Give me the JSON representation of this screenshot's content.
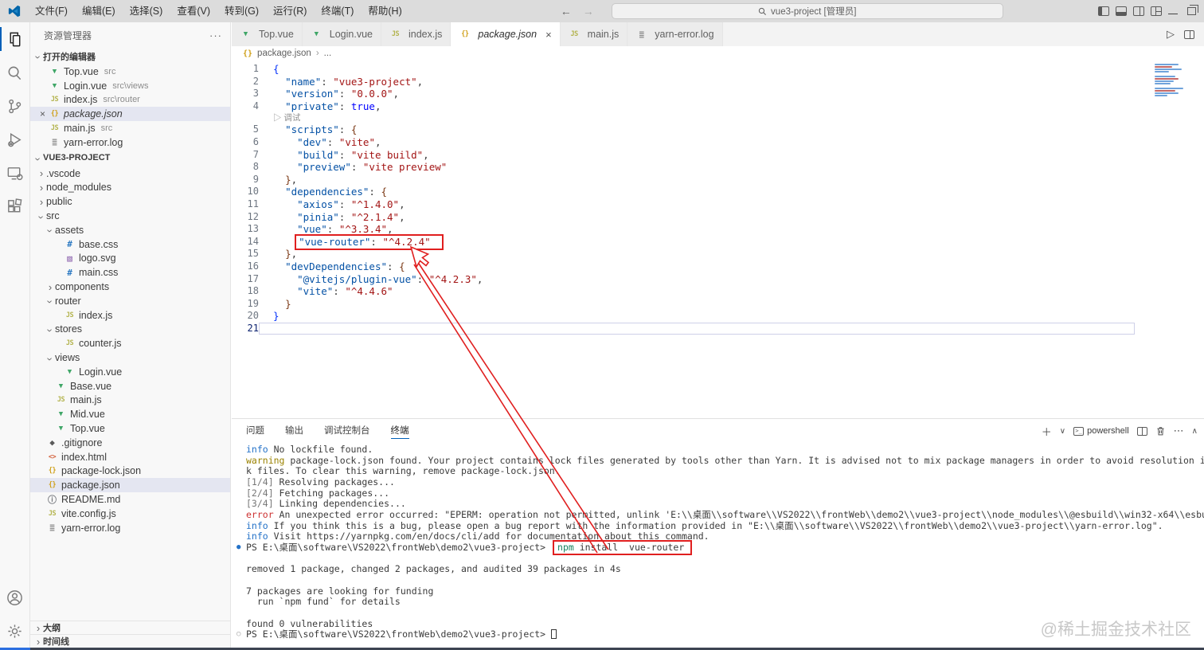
{
  "title_bar": {
    "menus": [
      "文件(F)",
      "编辑(E)",
      "选择(S)",
      "查看(V)",
      "转到(G)",
      "运行(R)",
      "终端(T)",
      "帮助(H)"
    ],
    "search_text": "vue3-project [管理员]",
    "window_controls": [
      "layout-sidebar-left",
      "layout-panel",
      "layout-sidebar-right",
      "customize-layout",
      "minimize",
      "restore"
    ]
  },
  "activity_bar": {
    "items": [
      "explorer-icon",
      "search-icon",
      "source-control-icon",
      "run-debug-icon",
      "remote-explorer-icon",
      "extensions-icon"
    ],
    "bottom_items": [
      "account-icon",
      "settings-gear-icon"
    ]
  },
  "sidebar": {
    "title": "资源管理器",
    "open_editors_label": "打开的编辑器",
    "open_editors": [
      {
        "icon": "vue",
        "name": "Top.vue",
        "path": "src"
      },
      {
        "icon": "vue",
        "name": "Login.vue",
        "path": "src\\views"
      },
      {
        "icon": "js",
        "name": "index.js",
        "path": "src\\router"
      },
      {
        "icon": "json",
        "name": "package.json",
        "path": "",
        "active": true
      },
      {
        "icon": "js",
        "name": "main.js",
        "path": "src"
      },
      {
        "icon": "log",
        "name": "yarn-error.log",
        "path": ""
      }
    ],
    "project_label": "VUE3-PROJECT",
    "tree": [
      {
        "label": ".vscode",
        "folder": "closed",
        "indent": 0
      },
      {
        "label": "node_modules",
        "folder": "closed",
        "indent": 0
      },
      {
        "label": "public",
        "folder": "closed",
        "indent": 0
      },
      {
        "label": "src",
        "folder": "open",
        "indent": 0
      },
      {
        "label": "assets",
        "folder": "open",
        "indent": 1
      },
      {
        "label": "base.css",
        "icon": "css",
        "indent": 2
      },
      {
        "label": "logo.svg",
        "icon": "svg",
        "indent": 2
      },
      {
        "label": "main.css",
        "icon": "css",
        "indent": 2
      },
      {
        "label": "components",
        "folder": "closed",
        "indent": 1
      },
      {
        "label": "router",
        "folder": "open",
        "indent": 1
      },
      {
        "label": "index.js",
        "icon": "js",
        "indent": 2
      },
      {
        "label": "stores",
        "folder": "open",
        "indent": 1
      },
      {
        "label": "counter.js",
        "icon": "js",
        "indent": 2
      },
      {
        "label": "views",
        "folder": "open",
        "indent": 1
      },
      {
        "label": "Login.vue",
        "icon": "vue",
        "indent": 2
      },
      {
        "label": "Base.vue",
        "icon": "vue",
        "indent": 1
      },
      {
        "label": "main.js",
        "icon": "js",
        "indent": 1
      },
      {
        "label": "Mid.vue",
        "icon": "vue",
        "indent": 1
      },
      {
        "label": "Top.vue",
        "icon": "vue",
        "indent": 1
      },
      {
        "label": ".gitignore",
        "icon": "git",
        "indent": 0
      },
      {
        "label": "index.html",
        "icon": "html",
        "indent": 0
      },
      {
        "label": "package-lock.json",
        "icon": "json",
        "indent": 0
      },
      {
        "label": "package.json",
        "icon": "json",
        "indent": 0,
        "selected": true
      },
      {
        "label": "README.md",
        "icon": "info",
        "indent": 0
      },
      {
        "label": "vite.config.js",
        "icon": "js",
        "indent": 0
      },
      {
        "label": "yarn-error.log",
        "icon": "log",
        "indent": 0
      }
    ],
    "bottom_sections": [
      "大纲",
      "时间线"
    ]
  },
  "editor": {
    "tabs": [
      {
        "icon": "vue",
        "label": "Top.vue"
      },
      {
        "icon": "vue",
        "label": "Login.vue"
      },
      {
        "icon": "js",
        "label": "index.js"
      },
      {
        "icon": "json",
        "label": "package.json",
        "active": true,
        "italic": true
      },
      {
        "icon": "js",
        "label": "main.js"
      },
      {
        "icon": "log",
        "label": "yarn-error.log"
      }
    ],
    "breadcrumb": {
      "file": "package.json",
      "more": "..."
    },
    "lines": [
      {
        "n": 1,
        "seg": [
          [
            "b1",
            "{"
          ]
        ]
      },
      {
        "n": 2,
        "seg": [
          [
            "p",
            "  "
          ],
          [
            "key",
            "\"name\""
          ],
          [
            "p",
            ": "
          ],
          [
            "str",
            "\"vue3-project\""
          ],
          [
            "p",
            ","
          ]
        ]
      },
      {
        "n": 3,
        "seg": [
          [
            "p",
            "  "
          ],
          [
            "key",
            "\"version\""
          ],
          [
            "p",
            ": "
          ],
          [
            "str",
            "\"0.0.0\""
          ],
          [
            "p",
            ","
          ]
        ]
      },
      {
        "n": 4,
        "seg": [
          [
            "p",
            "  "
          ],
          [
            "key",
            "\"private\""
          ],
          [
            "p",
            ": "
          ],
          [
            "kw",
            "true"
          ],
          [
            "p",
            ","
          ]
        ]
      },
      {
        "lens": "▷ 调试"
      },
      {
        "n": 5,
        "seg": [
          [
            "p",
            "  "
          ],
          [
            "key",
            "\"scripts\""
          ],
          [
            "p",
            ": "
          ],
          [
            "b2",
            "{"
          ]
        ]
      },
      {
        "n": 6,
        "seg": [
          [
            "p",
            "    "
          ],
          [
            "key",
            "\"dev\""
          ],
          [
            "p",
            ": "
          ],
          [
            "str",
            "\"vite\""
          ],
          [
            "p",
            ","
          ]
        ]
      },
      {
        "n": 7,
        "seg": [
          [
            "p",
            "    "
          ],
          [
            "key",
            "\"build\""
          ],
          [
            "p",
            ": "
          ],
          [
            "str",
            "\"vite build\""
          ],
          [
            "p",
            ","
          ]
        ]
      },
      {
        "n": 8,
        "seg": [
          [
            "p",
            "    "
          ],
          [
            "key",
            "\"preview\""
          ],
          [
            "p",
            ": "
          ],
          [
            "str",
            "\"vite preview\""
          ]
        ]
      },
      {
        "n": 9,
        "seg": [
          [
            "p",
            "  "
          ],
          [
            "b2",
            "}"
          ],
          [
            "p",
            ","
          ]
        ]
      },
      {
        "n": 10,
        "seg": [
          [
            "p",
            "  "
          ],
          [
            "key",
            "\"dependencies\""
          ],
          [
            "p",
            ": "
          ],
          [
            "b2",
            "{"
          ]
        ]
      },
      {
        "n": 11,
        "seg": [
          [
            "p",
            "    "
          ],
          [
            "key",
            "\"axios\""
          ],
          [
            "p",
            ": "
          ],
          [
            "str",
            "\"^1.4.0\""
          ],
          [
            "p",
            ","
          ]
        ]
      },
      {
        "n": 12,
        "seg": [
          [
            "p",
            "    "
          ],
          [
            "key",
            "\"pinia\""
          ],
          [
            "p",
            ": "
          ],
          [
            "str",
            "\"^2.1.4\""
          ],
          [
            "p",
            ","
          ]
        ]
      },
      {
        "n": 13,
        "seg": [
          [
            "p",
            "    "
          ],
          [
            "key",
            "\"vue\""
          ],
          [
            "p",
            ": "
          ],
          [
            "str",
            "\"^3.3.4\""
          ],
          [
            "p",
            ","
          ]
        ]
      },
      {
        "n": 14,
        "seg": [
          [
            "p",
            "    "
          ],
          [
            "rbox",
            [
              [
                "key",
                "\"vue-router\""
              ],
              [
                "p",
                ": "
              ],
              [
                "str",
                "\"^4.2.4\""
              ]
            ]
          ]
        ]
      },
      {
        "n": 15,
        "seg": [
          [
            "p",
            "  "
          ],
          [
            "b2",
            "}"
          ],
          [
            "p",
            ","
          ]
        ]
      },
      {
        "n": 16,
        "seg": [
          [
            "p",
            "  "
          ],
          [
            "key",
            "\"devDependencies\""
          ],
          [
            "p",
            ": "
          ],
          [
            "b2",
            "{"
          ]
        ]
      },
      {
        "n": 17,
        "seg": [
          [
            "p",
            "    "
          ],
          [
            "key",
            "\"@vitejs/plugin-vue\""
          ],
          [
            "p",
            ": "
          ],
          [
            "str",
            "\"^4.2.3\""
          ],
          [
            "p",
            ","
          ]
        ]
      },
      {
        "n": 18,
        "seg": [
          [
            "p",
            "    "
          ],
          [
            "key",
            "\"vite\""
          ],
          [
            "p",
            ": "
          ],
          [
            "str",
            "\"^4.4.6\""
          ]
        ]
      },
      {
        "n": 19,
        "seg": [
          [
            "p",
            "  "
          ],
          [
            "b2",
            "}"
          ]
        ]
      },
      {
        "n": 20,
        "seg": [
          [
            "b1",
            "}"
          ]
        ]
      },
      {
        "n": 21,
        "seg": [],
        "current": true
      }
    ]
  },
  "panel": {
    "tabs": [
      "问题",
      "输出",
      "调试控制台",
      "终端"
    ],
    "active_tab": "终端",
    "shell_label": "powershell",
    "terminal_lines": [
      {
        "seg": [
          [
            "info",
            "info"
          ],
          [
            "t",
            " No lockfile found."
          ]
        ]
      },
      {
        "seg": [
          [
            "warn",
            "warning"
          ],
          [
            "t",
            " package-lock.json found. Your project contains lock files generated by tools other than Yarn. It is advised not to mix package managers in order to avoid resolution inconsistencies caused by unsynchronized"
          ]
        ]
      },
      {
        "seg": [
          [
            "t",
            "k files. To clear this warning, remove package-lock.json."
          ]
        ]
      },
      {
        "seg": [
          [
            "step",
            "[1/4]"
          ],
          [
            "t",
            " Resolving packages..."
          ]
        ]
      },
      {
        "seg": [
          [
            "step",
            "[2/4]"
          ],
          [
            "t",
            " Fetching packages..."
          ]
        ]
      },
      {
        "seg": [
          [
            "step",
            "[3/4]"
          ],
          [
            "t",
            " Linking dependencies..."
          ]
        ]
      },
      {
        "seg": [
          [
            "err",
            "error"
          ],
          [
            "t",
            " An unexpected error occurred: \"EPERM: operation not permitted, unlink 'E:\\\\桌面\\\\software\\\\VS2022\\\\frontWeb\\\\demo2\\\\vue3-project\\\\node_modules\\\\@esbuild\\\\win32-x64\\\\esbuild.exe'\"."
          ]
        ]
      },
      {
        "seg": [
          [
            "info",
            "info"
          ],
          [
            "t",
            " If you think this is a bug, please open a bug report with the information provided in \"E:\\\\桌面\\\\software\\\\VS2022\\\\frontWeb\\\\demo2\\\\vue3-project\\\\yarn-error.log\"."
          ]
        ]
      },
      {
        "seg": [
          [
            "info",
            "info"
          ],
          [
            "t",
            " Visit https://yarnpkg.com/en/docs/cli/add for documentation about this command."
          ]
        ]
      },
      {
        "dot": "blue",
        "seg": [
          [
            "t",
            "PS E:\\桌面\\software\\VS2022\\frontWeb\\demo2\\vue3-project> "
          ],
          [
            "box",
            [
              [
                "npm",
                "npm"
              ],
              [
                "t",
                " install  vue-router"
              ]
            ]
          ]
        ]
      },
      {
        "seg": []
      },
      {
        "seg": [
          [
            "t",
            "removed 1 package, changed 2 packages, and audited 39 packages in 4s"
          ]
        ]
      },
      {
        "seg": []
      },
      {
        "seg": [
          [
            "t",
            "7 packages are looking for funding"
          ]
        ]
      },
      {
        "seg": [
          [
            "t",
            "  run `npm fund` for details"
          ]
        ]
      },
      {
        "seg": []
      },
      {
        "seg": [
          [
            "t",
            "found 0 vulnerabilities"
          ]
        ]
      },
      {
        "dot": "hollow",
        "seg": [
          [
            "t",
            "PS E:\\桌面\\software\\VS2022\\frontWeb\\demo2\\vue3-project> "
          ],
          [
            "cursor",
            ""
          ]
        ]
      }
    ]
  },
  "watermark": "@稀土掘金技术社区"
}
